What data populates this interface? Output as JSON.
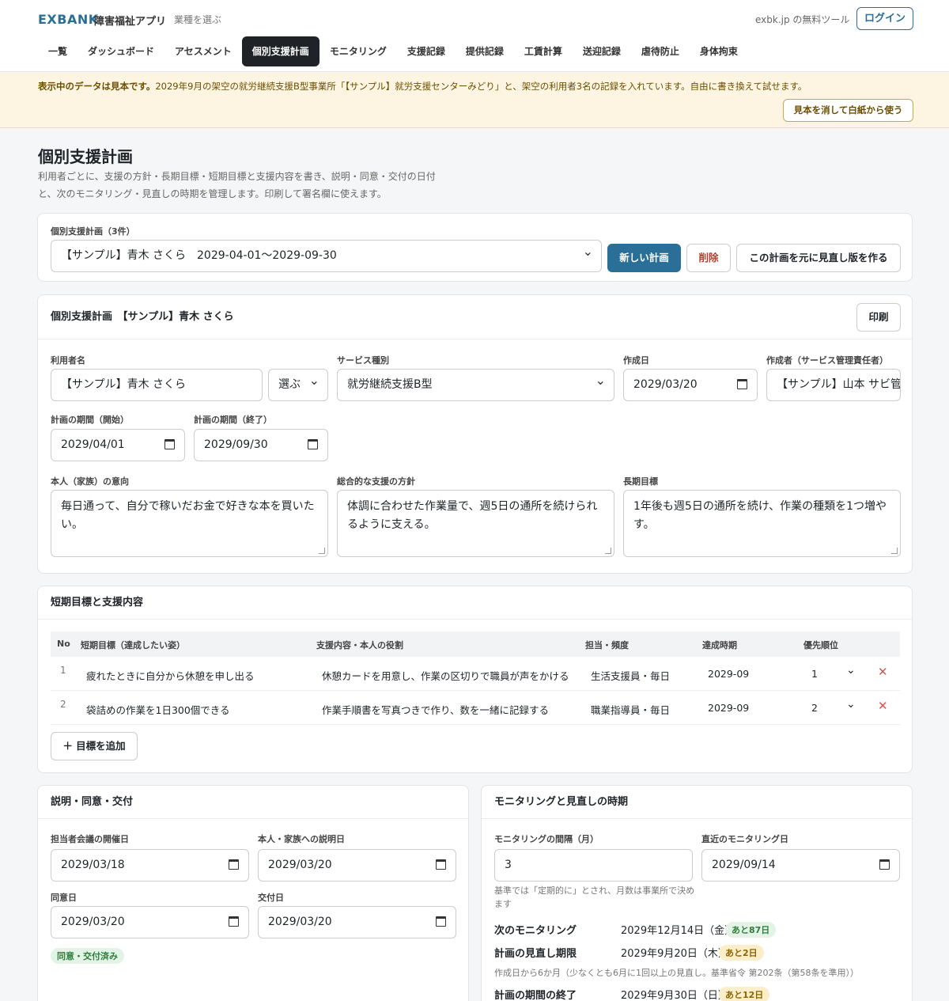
{
  "header": {
    "brand": "EXBANK",
    "app_name": "障害福祉アプリ",
    "industry_link": "業種を選ぶ",
    "free_tool": "exbk.jp の無料ツール",
    "login": "ログイン"
  },
  "nav": [
    "一覧",
    "ダッシュボード",
    "アセスメント",
    "個別支援計画",
    "モニタリング",
    "支援記録",
    "提供記録",
    "工賃計算",
    "送迎記録",
    "虐待防止",
    "身体拘束"
  ],
  "nav_active": "個別支援計画",
  "banner": {
    "bold": "表示中のデータは見本です。",
    "text": "2029年9月の架空の就労継続支援B型事業所「【サンプル】就労支援センターみどり」と、架空の利用者3名の記録を入れています。自由に書き換えて試せます。",
    "button": "見本を消して白紙から使う"
  },
  "page": {
    "title": "個別支援計画",
    "lead": "利用者ごとに、支援の方針・長期目標・短期目標と支援内容を書き、説明・同意・交付の日付と、次のモニタリング・見直しの時期を管理します。印刷して署名欄に使えます。"
  },
  "selector": {
    "label": "個別支援計画（3件）",
    "value": "【サンプル】青木 さくら　2029-04-01〜2029-09-30",
    "new": "新しい計画",
    "delete": "削除",
    "revise": "この計画を元に見直し版を作る"
  },
  "plan": {
    "heading": "個別支援計画　【サンプル】青木 さくら",
    "print": "印刷",
    "user_label": "利用者名",
    "user_value": "【サンプル】青木 さくら",
    "user_pick": "選ぶ",
    "service_label": "サービス種別",
    "service_value": "就労継続支援B型",
    "created_label": "作成日",
    "created_value": "2029/03/20",
    "author_label": "作成者（サービス管理責任者）",
    "author_value": "【サンプル】山本 サビ管",
    "start_label": "計画の期間（開始）",
    "start_value": "2029/04/01",
    "end_label": "計画の期間（終了）",
    "end_value": "2029/09/30",
    "wish_label": "本人（家族）の意向",
    "wish_value": "毎日通って、自分で稼いだお金で好きな本を買いたい。",
    "policy_label": "総合的な支援の方針",
    "policy_value": "体調に合わせた作業量で、週5日の通所を続けられるように支える。",
    "longterm_label": "長期目標",
    "longterm_value": "1年後も週5日の通所を続け、作業の種類を1つ増やす。"
  },
  "goals": {
    "heading": "短期目標と支援内容",
    "columns": [
      "No",
      "短期目標（達成したい姿）",
      "支援内容・本人の役割",
      "担当・頻度",
      "達成時期",
      "優先順位"
    ],
    "rows": [
      {
        "no": "1",
        "goal": "疲れたときに自分から休憩を申し出る",
        "support": "休憩カードを用意し、作業の区切りで職員が声をかける",
        "staff": "生活支援員・毎日",
        "due": "2029-09",
        "priority": "1"
      },
      {
        "no": "2",
        "goal": "袋詰めの作業を1日300個できる",
        "support": "作業手順書を写真つきで作り、数を一緒に記録する",
        "staff": "職業指導員・毎日",
        "due": "2029-09",
        "priority": "2"
      }
    ],
    "add": "＋ 目標を追加"
  },
  "consent": {
    "heading": "説明・同意・交付",
    "meeting_label": "担当者会議の開催日",
    "meeting_value": "2029/03/18",
    "explain_label": "本人・家族への説明日",
    "explain_value": "2029/03/20",
    "agree_label": "同意日",
    "agree_value": "2029/03/20",
    "deliver_label": "交付日",
    "deliver_value": "2029/03/20",
    "status": "同意・交付済み"
  },
  "monitoring": {
    "heading": "モニタリングと見直しの時期",
    "interval_label": "モニタリングの間隔（月）",
    "interval_value": "3",
    "recent_label": "直近のモニタリング日",
    "recent_value": "2029/09/14",
    "interval_note": "基準では「定期的に」とされ、月数は事業所で決めます",
    "next_label": "次のモニタリング",
    "next_value": "2029年12月14日（金）",
    "next_badge": "あと87日",
    "review_label": "計画の見直し期限",
    "review_value": "2029年9月20日（木）",
    "review_badge": "あと2日",
    "review_note": "作成日から6か月（少なくとも6月に1回以上の見直し。基準省令 第202条（第58条を準用））",
    "end_label": "計画の期間の終了",
    "end_value": "2029年9月30日（日）",
    "end_badge": "あと12日"
  },
  "colors": {
    "accent": "#2a6f97",
    "banner_bg": "#fdf5e1",
    "danger": "#c0392b"
  }
}
